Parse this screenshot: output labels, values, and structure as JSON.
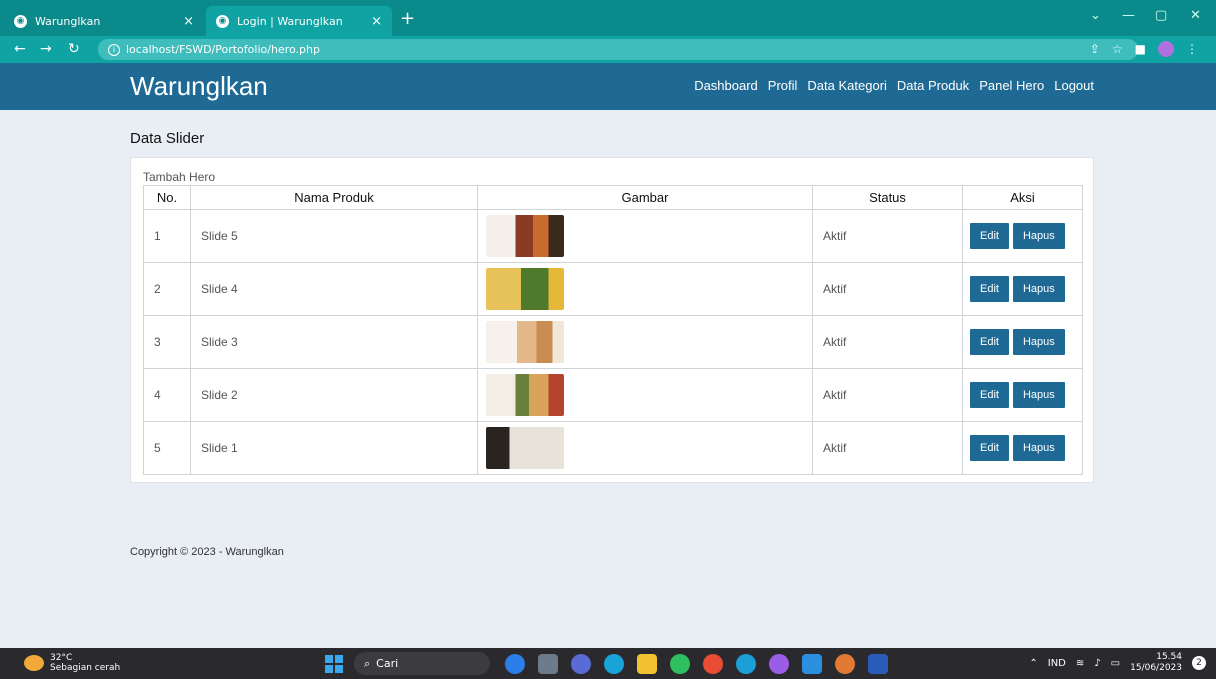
{
  "browser": {
    "tabs": [
      {
        "label": "Warunglkan"
      },
      {
        "label": "Login | Warunglkan"
      }
    ],
    "url": "localhost/FSWD/Portofolio/hero.php"
  },
  "site": {
    "brand": "Warunglkan",
    "nav": [
      "Dashboard",
      "Profil",
      "Data Kategori",
      "Data Produk",
      "Panel Hero",
      "Logout"
    ]
  },
  "main": {
    "title": "Data Slider",
    "add_link": "Tambah Hero",
    "table": {
      "headers": [
        "No.",
        "Nama Produk",
        "Gambar",
        "Status",
        "Aksi"
      ],
      "rows": [
        {
          "no": "1",
          "nama": "Slide 5",
          "status": "Aktif",
          "edit": "Edit",
          "hapus": "Hapus"
        },
        {
          "no": "2",
          "nama": "Slide 4",
          "status": "Aktif",
          "edit": "Edit",
          "hapus": "Hapus"
        },
        {
          "no": "3",
          "nama": "Slide 3",
          "status": "Aktif",
          "edit": "Edit",
          "hapus": "Hapus"
        },
        {
          "no": "4",
          "nama": "Slide 2",
          "status": "Aktif",
          "edit": "Edit",
          "hapus": "Hapus"
        },
        {
          "no": "5",
          "nama": "Slide 1",
          "status": "Aktif",
          "edit": "Edit",
          "hapus": "Hapus"
        }
      ]
    }
  },
  "footer": {
    "text": "Copyright © 2023 - Warunglkan"
  },
  "taskbar": {
    "temp": "32°C",
    "weather": "Sebagian cerah",
    "search": "Cari",
    "lang": "IND",
    "time": "15.54",
    "date": "15/06/2023",
    "notif_count": "2"
  }
}
